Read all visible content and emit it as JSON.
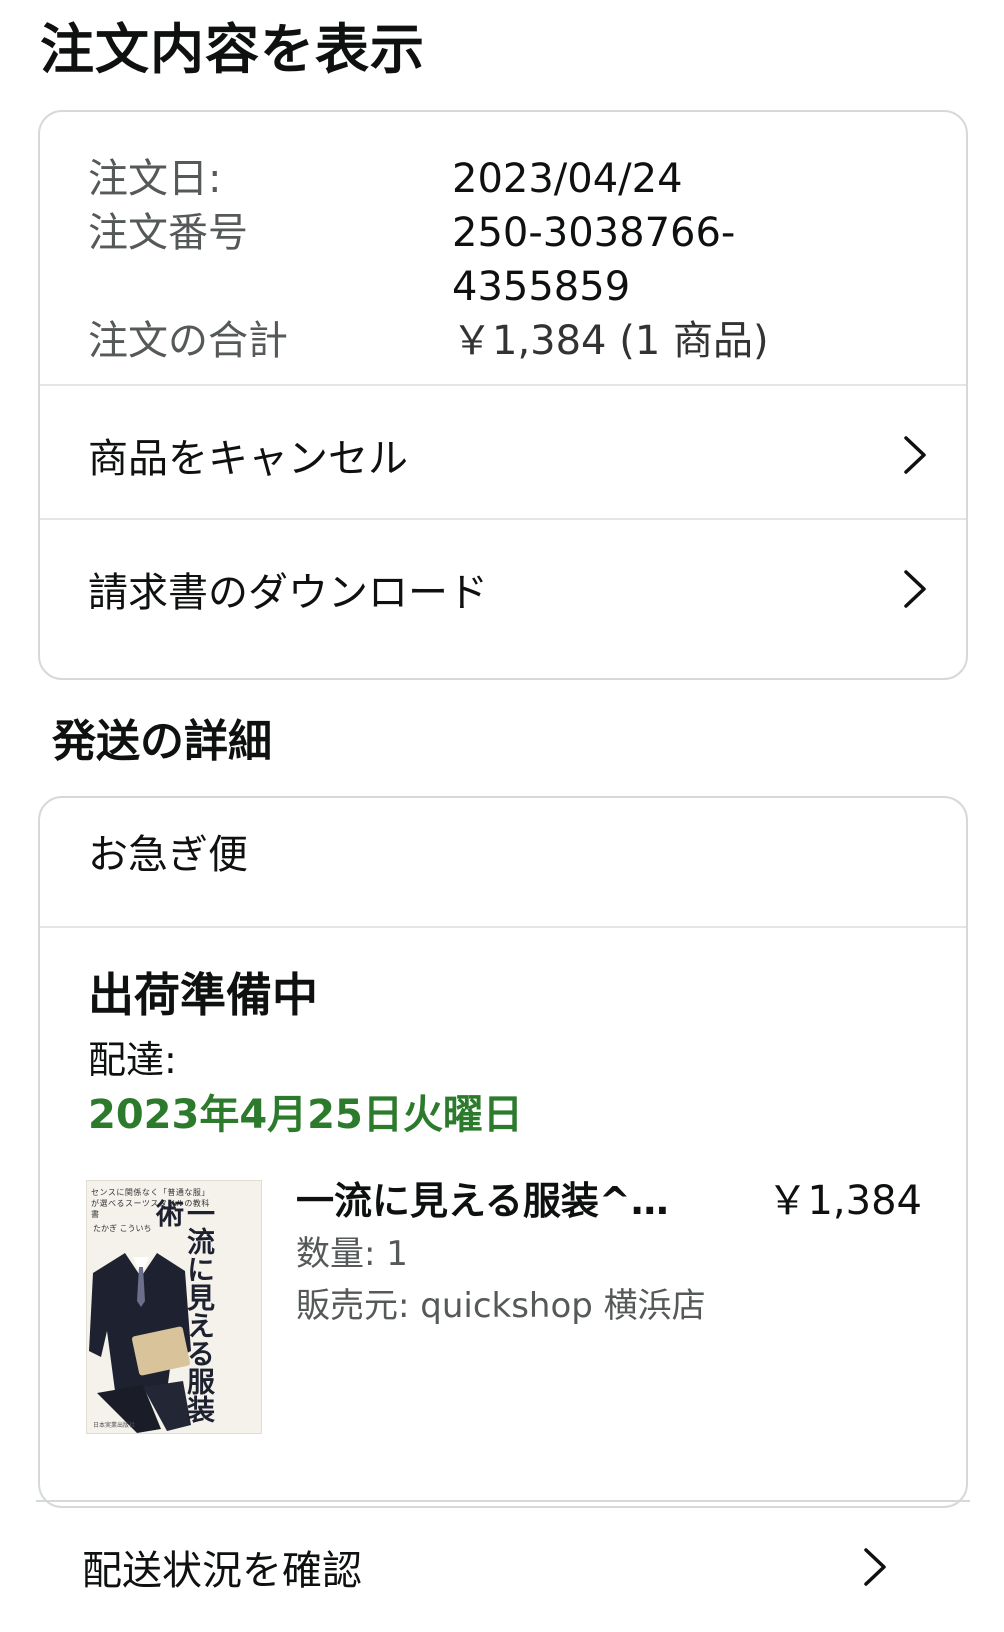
{
  "page": {
    "title": "注文内容を表示"
  },
  "order": {
    "date_label": "注文日:",
    "date_value": "2023/04/24",
    "number_label": "注文番号",
    "number_value_1": "250-3038766-",
    "number_value_2": "4355859",
    "total_label": "注文の合計",
    "total_value": "￥1,384 (1 商品)"
  },
  "actions": {
    "cancel_label": "商品をキャンセル",
    "invoice_label": "請求書のダウンロード"
  },
  "shipping": {
    "section_title": "発送の詳細",
    "speed": "お急ぎ便",
    "status": "出荷準備中",
    "delivery_label": "配達:",
    "delivery_date": "2023年4月25日火曜日",
    "delivery_date_color": "#2c7a2c",
    "product": {
      "name": "一流に見える服装^…",
      "price": "￥1,384",
      "quantity": "数量: 1",
      "seller": "販売元: quickshop 横浜店",
      "cover": {
        "title": "一流に見える服装術",
        "blurb": "センスに関係なく「普通な服」が選べるスーツスタイルの教科書",
        "author": "たかぎ こういち",
        "publisher": "日本実業出版社"
      }
    }
  },
  "tracking": {
    "label": "配送状況を確認"
  },
  "icons": {
    "chevron": "chevron-right-icon"
  }
}
